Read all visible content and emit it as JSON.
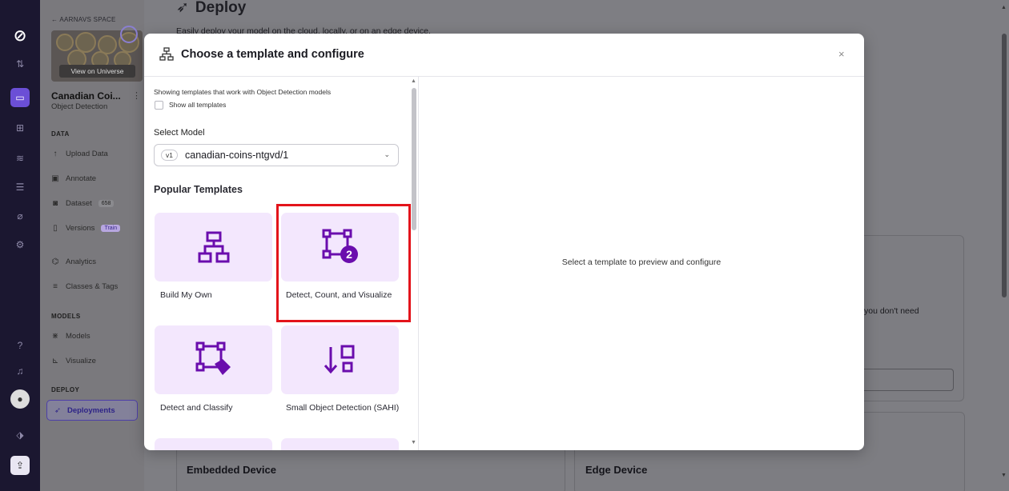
{
  "rail": {
    "icons": [
      "roboflow-logo-icon",
      "arrows-icon",
      "projects-icon",
      "workflows-icon",
      "monitoring-icon",
      "stack-icon",
      "brush-icon",
      "settings-icon",
      "help-icon",
      "notifications-icon",
      "user-avatar",
      "deploy-icon",
      "upload-icon"
    ]
  },
  "sidebar": {
    "back_label": "← AARNAVS SPACE",
    "view_on_universe": "View on Universe",
    "project_name": "Canadian Coi...",
    "project_type": "Object Detection",
    "more": "⋮",
    "section_data": "DATA",
    "upload": "Upload Data",
    "annotate": "Annotate",
    "dataset": "Dataset",
    "dataset_count": "658",
    "versions": "Versions",
    "train_badge": "Train",
    "analytics": "Analytics",
    "classes": "Classes & Tags",
    "section_models": "MODELS",
    "models": "Models",
    "visualize": "Visualize",
    "section_deploy": "DEPLOY",
    "deployments": "Deployments"
  },
  "page": {
    "title": "Deploy",
    "subtitle": "Easily deploy your model on the cloud, locally, or on an edge device.",
    "partial_text": "you don't need",
    "embedded": "Embedded Device",
    "edge": "Edge Device"
  },
  "modal": {
    "title": "Choose a template and configure",
    "close": "×",
    "showing": "Showing templates that work with Object Detection models",
    "show_all": "Show all templates",
    "select_model_label": "Select Model",
    "model_version": "v1",
    "model_value": "canadian-coins-ntgvd/1",
    "popular": "Popular Templates",
    "templates": [
      {
        "label": "Build My Own",
        "icon": "sitemap-icon"
      },
      {
        "label": "Detect, Count, and Visualize",
        "icon": "detect-count-icon"
      },
      {
        "label": "Detect and Classify",
        "icon": "detect-classify-icon"
      },
      {
        "label": "Small Object Detection (SAHI)",
        "icon": "small-object-icon"
      }
    ],
    "placeholder": "Select a template to preview and configure"
  },
  "colors": {
    "accent": "#6a0dad",
    "tile_bg": "#f3e7fd",
    "highlight": "#e3141b",
    "rail_bg": "#1b1730"
  }
}
